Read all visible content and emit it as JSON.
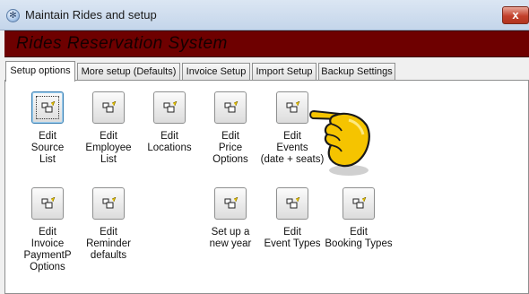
{
  "window": {
    "title": "Maintain Rides and setup",
    "close_glyph": "x"
  },
  "banner": {
    "text": "Rides Reservation  System"
  },
  "tabs": [
    {
      "label": "Setup options",
      "active": true
    },
    {
      "label": "More setup (Defaults)",
      "active": false
    },
    {
      "label": "Invoice Setup",
      "active": false
    },
    {
      "label": "Import Setup",
      "active": false
    },
    {
      "label": "Backup Settings",
      "active": false
    }
  ],
  "buttons": [
    {
      "label": "Edit\nSource\nList",
      "icon": "form-edit-icon"
    },
    {
      "label": "Edit\nEmployee\nList",
      "icon": "form-edit-icon"
    },
    {
      "label": "Edit\nLocations",
      "icon": "form-edit-icon"
    },
    {
      "label": "Edit\nPrice\nOptions",
      "icon": "form-edit-icon"
    },
    {
      "label": "Edit\nEvents\n(date + seats)",
      "icon": "form-edit-icon"
    },
    {
      "label": "Edit\nInvoice\nPaymentP\nOptions",
      "icon": "form-edit-icon"
    },
    {
      "label": "Edit\nReminder\ndefaults",
      "icon": "form-edit-icon"
    },
    {
      "label": "Set up a\nnew year",
      "icon": "form-edit-icon"
    },
    {
      "label": "Edit\nEvent Types",
      "icon": "form-edit-icon"
    },
    {
      "label": "Edit\nBooking Types",
      "icon": "form-edit-icon"
    }
  ],
  "colors": {
    "banner_bg": "#6e0000",
    "banner_text": "#140000",
    "hand": "#f5c400"
  }
}
